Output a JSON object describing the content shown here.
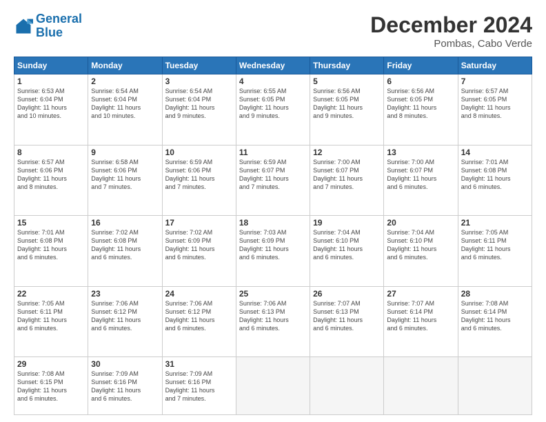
{
  "header": {
    "logo_line1": "General",
    "logo_line2": "Blue",
    "month": "December 2024",
    "location": "Pombas, Cabo Verde"
  },
  "weekdays": [
    "Sunday",
    "Monday",
    "Tuesday",
    "Wednesday",
    "Thursday",
    "Friday",
    "Saturday"
  ],
  "weeks": [
    [
      {
        "day": "1",
        "lines": [
          "Sunrise: 6:53 AM",
          "Sunset: 6:04 PM",
          "Daylight: 11 hours",
          "and 10 minutes."
        ]
      },
      {
        "day": "2",
        "lines": [
          "Sunrise: 6:54 AM",
          "Sunset: 6:04 PM",
          "Daylight: 11 hours",
          "and 10 minutes."
        ]
      },
      {
        "day": "3",
        "lines": [
          "Sunrise: 6:54 AM",
          "Sunset: 6:04 PM",
          "Daylight: 11 hours",
          "and 9 minutes."
        ]
      },
      {
        "day": "4",
        "lines": [
          "Sunrise: 6:55 AM",
          "Sunset: 6:05 PM",
          "Daylight: 11 hours",
          "and 9 minutes."
        ]
      },
      {
        "day": "5",
        "lines": [
          "Sunrise: 6:56 AM",
          "Sunset: 6:05 PM",
          "Daylight: 11 hours",
          "and 9 minutes."
        ]
      },
      {
        "day": "6",
        "lines": [
          "Sunrise: 6:56 AM",
          "Sunset: 6:05 PM",
          "Daylight: 11 hours",
          "and 8 minutes."
        ]
      },
      {
        "day": "7",
        "lines": [
          "Sunrise: 6:57 AM",
          "Sunset: 6:05 PM",
          "Daylight: 11 hours",
          "and 8 minutes."
        ]
      }
    ],
    [
      {
        "day": "8",
        "lines": [
          "Sunrise: 6:57 AM",
          "Sunset: 6:06 PM",
          "Daylight: 11 hours",
          "and 8 minutes."
        ]
      },
      {
        "day": "9",
        "lines": [
          "Sunrise: 6:58 AM",
          "Sunset: 6:06 PM",
          "Daylight: 11 hours",
          "and 7 minutes."
        ]
      },
      {
        "day": "10",
        "lines": [
          "Sunrise: 6:59 AM",
          "Sunset: 6:06 PM",
          "Daylight: 11 hours",
          "and 7 minutes."
        ]
      },
      {
        "day": "11",
        "lines": [
          "Sunrise: 6:59 AM",
          "Sunset: 6:07 PM",
          "Daylight: 11 hours",
          "and 7 minutes."
        ]
      },
      {
        "day": "12",
        "lines": [
          "Sunrise: 7:00 AM",
          "Sunset: 6:07 PM",
          "Daylight: 11 hours",
          "and 7 minutes."
        ]
      },
      {
        "day": "13",
        "lines": [
          "Sunrise: 7:00 AM",
          "Sunset: 6:07 PM",
          "Daylight: 11 hours",
          "and 6 minutes."
        ]
      },
      {
        "day": "14",
        "lines": [
          "Sunrise: 7:01 AM",
          "Sunset: 6:08 PM",
          "Daylight: 11 hours",
          "and 6 minutes."
        ]
      }
    ],
    [
      {
        "day": "15",
        "lines": [
          "Sunrise: 7:01 AM",
          "Sunset: 6:08 PM",
          "Daylight: 11 hours",
          "and 6 minutes."
        ]
      },
      {
        "day": "16",
        "lines": [
          "Sunrise: 7:02 AM",
          "Sunset: 6:08 PM",
          "Daylight: 11 hours",
          "and 6 minutes."
        ]
      },
      {
        "day": "17",
        "lines": [
          "Sunrise: 7:02 AM",
          "Sunset: 6:09 PM",
          "Daylight: 11 hours",
          "and 6 minutes."
        ]
      },
      {
        "day": "18",
        "lines": [
          "Sunrise: 7:03 AM",
          "Sunset: 6:09 PM",
          "Daylight: 11 hours",
          "and 6 minutes."
        ]
      },
      {
        "day": "19",
        "lines": [
          "Sunrise: 7:04 AM",
          "Sunset: 6:10 PM",
          "Daylight: 11 hours",
          "and 6 minutes."
        ]
      },
      {
        "day": "20",
        "lines": [
          "Sunrise: 7:04 AM",
          "Sunset: 6:10 PM",
          "Daylight: 11 hours",
          "and 6 minutes."
        ]
      },
      {
        "day": "21",
        "lines": [
          "Sunrise: 7:05 AM",
          "Sunset: 6:11 PM",
          "Daylight: 11 hours",
          "and 6 minutes."
        ]
      }
    ],
    [
      {
        "day": "22",
        "lines": [
          "Sunrise: 7:05 AM",
          "Sunset: 6:11 PM",
          "Daylight: 11 hours",
          "and 6 minutes."
        ]
      },
      {
        "day": "23",
        "lines": [
          "Sunrise: 7:06 AM",
          "Sunset: 6:12 PM",
          "Daylight: 11 hours",
          "and 6 minutes."
        ]
      },
      {
        "day": "24",
        "lines": [
          "Sunrise: 7:06 AM",
          "Sunset: 6:12 PM",
          "Daylight: 11 hours",
          "and 6 minutes."
        ]
      },
      {
        "day": "25",
        "lines": [
          "Sunrise: 7:06 AM",
          "Sunset: 6:13 PM",
          "Daylight: 11 hours",
          "and 6 minutes."
        ]
      },
      {
        "day": "26",
        "lines": [
          "Sunrise: 7:07 AM",
          "Sunset: 6:13 PM",
          "Daylight: 11 hours",
          "and 6 minutes."
        ]
      },
      {
        "day": "27",
        "lines": [
          "Sunrise: 7:07 AM",
          "Sunset: 6:14 PM",
          "Daylight: 11 hours",
          "and 6 minutes."
        ]
      },
      {
        "day": "28",
        "lines": [
          "Sunrise: 7:08 AM",
          "Sunset: 6:14 PM",
          "Daylight: 11 hours",
          "and 6 minutes."
        ]
      }
    ],
    [
      {
        "day": "29",
        "lines": [
          "Sunrise: 7:08 AM",
          "Sunset: 6:15 PM",
          "Daylight: 11 hours",
          "and 6 minutes."
        ]
      },
      {
        "day": "30",
        "lines": [
          "Sunrise: 7:09 AM",
          "Sunset: 6:16 PM",
          "Daylight: 11 hours",
          "and 6 minutes."
        ]
      },
      {
        "day": "31",
        "lines": [
          "Sunrise: 7:09 AM",
          "Sunset: 6:16 PM",
          "Daylight: 11 hours",
          "and 7 minutes."
        ]
      },
      {
        "day": "",
        "lines": []
      },
      {
        "day": "",
        "lines": []
      },
      {
        "day": "",
        "lines": []
      },
      {
        "day": "",
        "lines": []
      }
    ]
  ]
}
